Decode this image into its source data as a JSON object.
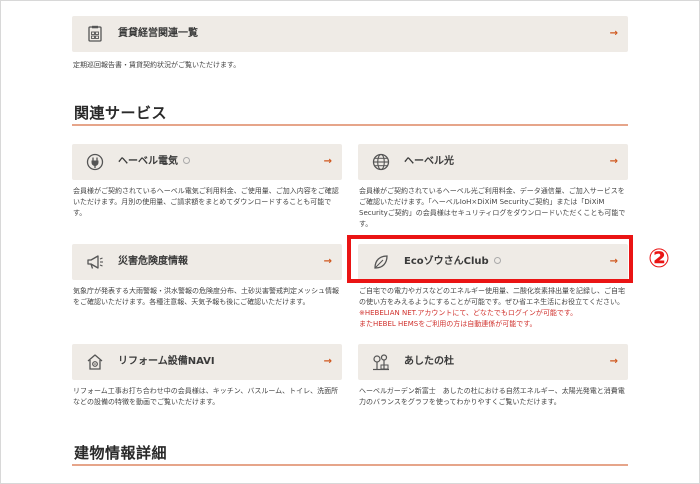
{
  "top_card": {
    "label": "賃貸経営関連一覧",
    "arrow": "→",
    "icon": "document-icon"
  },
  "top_desc": "定期巡回報告書・賃貸契約状況がご覧いただけます。",
  "section_related": "関連サービス",
  "section_building": "建物情報詳細",
  "cards": {
    "denki": {
      "label": "ヘーベル電気",
      "arrow": "→",
      "icon": "plug-icon",
      "desc": "会員様がご契約されているヘーベル電気ご利用料金、ご使用量、ご加入内容をご確認いただけます。月別の使用量、ご請求額をまとめてダウンロードすることも可能です。"
    },
    "hikari": {
      "label": "ヘーベル光",
      "arrow": "→",
      "icon": "globe-icon",
      "desc": "会員様がご契約されているヘーベル光ご利用料金、データ通信量、ご加入サービスをご確認いただけます。「ヘーベルIoH×DiXiM Securityご契約」または「DiXiM Securityご契約」の会員様はセキュリティログをダウンロードいただくことも可能です。"
    },
    "saigai": {
      "label": "災害危険度情報",
      "arrow": "→",
      "icon": "megaphone-icon",
      "desc": "気象庁が発表する大雨警報・洪水警報の危険度分布、土砂災害警戒判定メッシュ情報をご確認いただけます。各種注意報、天気予報も後にご確認いただけます。"
    },
    "eco": {
      "label": "EcoゾウさんClub",
      "arrow": "→",
      "icon": "leaf-icon",
      "desc": "ご自宅での電力やガスなどのエネルギー使用量、二酸化炭素排出量を記録し、ご自宅の使い方をみえるようにすることが可能です。ぜひ省エネ生活にお役立てください。",
      "note1": "※HEBELIAN NET.アカウントにて、どなたでもログインが可能です。",
      "note2": "またHEBEL HEMSをご利用の方は自動連係が可能です。"
    },
    "reform": {
      "label": "リフォーム設備NAVI",
      "arrow": "→",
      "icon": "house-gear-icon",
      "desc": "リフォーム工事お打ち合わせ中の会員様は、キッチン、バスルーム、トイレ、洗面所などの設備の特徴を動画でご覧いただけます。"
    },
    "ashita": {
      "label": "あしたの杜",
      "arrow": "→",
      "icon": "trees-icon",
      "desc": "ヘーベルガーデン新富士　あしたの杜における自然エネルギー、太陽光発電と消費電力のバランスをグラフを使ってわかりやすくご覧いただけます。"
    }
  },
  "marker": "②",
  "colors": {
    "card_bg": "#efebe6",
    "accent": "#d0581f",
    "highlight": "#ea1414",
    "section_line": "#e6a58a"
  }
}
